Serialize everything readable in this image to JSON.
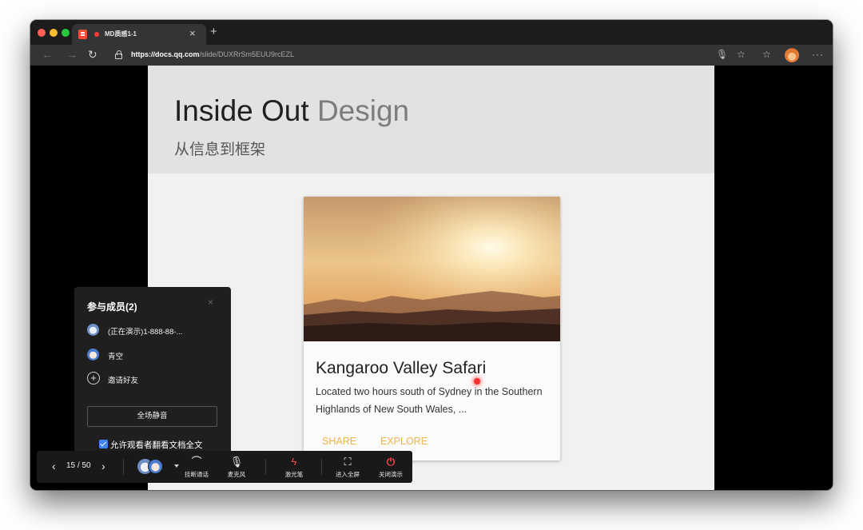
{
  "browser": {
    "tab_title": "MD质感1-1",
    "tab_close": "×",
    "new_tab": "+",
    "url_host": "https://docs.qq.com",
    "url_path": "/slide/DUXRrSm5EUU9rcEZL",
    "icons": [
      "back-arrow-icon",
      "forward-arrow-icon",
      "reload-icon",
      "lock-icon",
      "microphone-icon",
      "star-icon",
      "favorites-icon",
      "profile-avatar",
      "more-icon"
    ]
  },
  "slide": {
    "title_dark": "Inside Out",
    "title_light": "Design",
    "subtitle": "从信息到框架",
    "card": {
      "title": "Kangaroo Valley Safari",
      "text": "Located two hours south of Sydney in the Southern Highlands of New South Wales, ...",
      "share": "SHARE",
      "explore": "EXPLORE",
      "accent": "#f0b44a"
    }
  },
  "members": {
    "title": "参与成员(2)",
    "close": "×",
    "list": [
      {
        "name": "(正在演示)1-888-88-..."
      },
      {
        "name": "青空"
      }
    ],
    "invite": "邀请好友",
    "mute_all": "全场静音",
    "allow_label": "允许观看者翻看文档全文",
    "allow_checked": true
  },
  "controls": {
    "prev": "‹",
    "page": "15 / 50",
    "next": "›",
    "hangup": "挂断通话",
    "mic": "麦克风",
    "laser": "激光笔",
    "fullscreen": "进入全屏",
    "close": "关闭演示",
    "accent_red": "#ff4646"
  }
}
